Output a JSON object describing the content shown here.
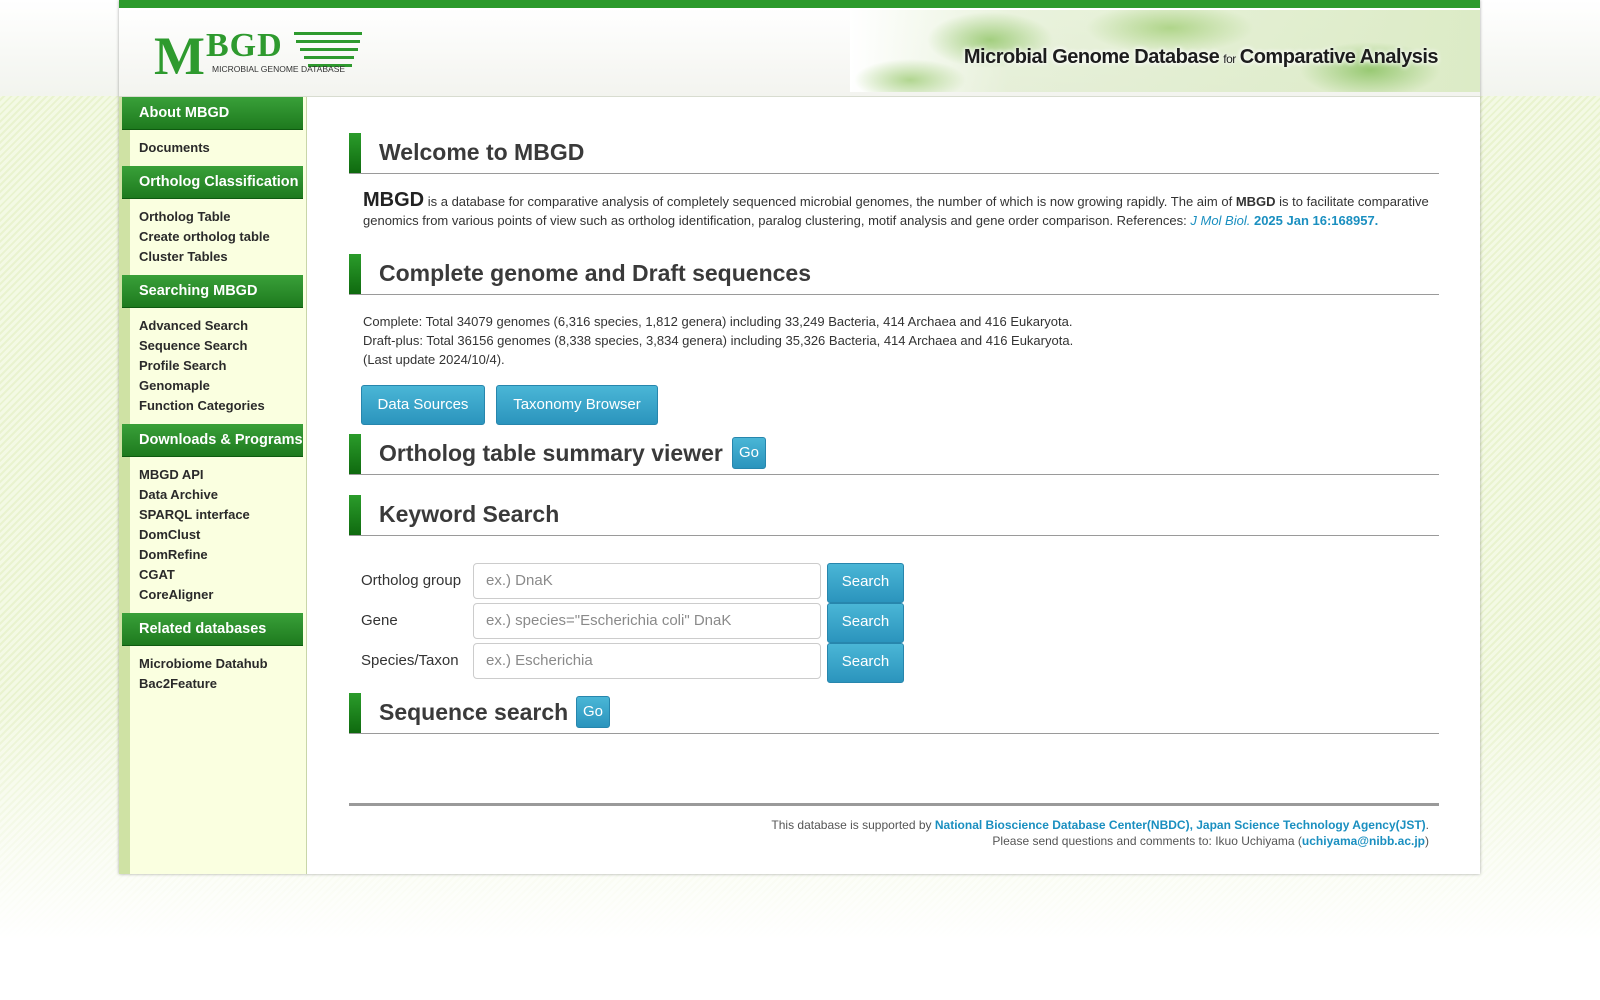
{
  "header": {
    "logo_text": "MBGD",
    "logo_subtext": "MICROBIAL GENOME DATABASE",
    "tagline_part1": "Microbial Genome Database",
    "tagline_for": "for",
    "tagline_part2": "Comparative Analysis"
  },
  "sidebar": {
    "sections": [
      {
        "title": "About MBGD",
        "items": [
          "Documents"
        ]
      },
      {
        "title": "Ortholog Classification",
        "items": [
          "Ortholog Table",
          "Create ortholog table",
          "Cluster Tables"
        ]
      },
      {
        "title": "Searching MBGD",
        "items": [
          "Advanced Search",
          "Sequence Search",
          "Profile Search",
          "Genomaple",
          "Function Categories"
        ]
      },
      {
        "title": "Downloads & Programs",
        "items": [
          "MBGD API",
          "Data Archive",
          "SPARQL interface",
          "DomClust",
          "DomRefine",
          "CGAT",
          "CoreAligner"
        ]
      },
      {
        "title": "Related databases",
        "items": [
          "Microbiome Datahub",
          "Bac2Feature"
        ]
      }
    ]
  },
  "welcome": {
    "title": "Welcome to MBGD",
    "mbgd": "MBGD",
    "text1": " is a database for comparative analysis of completely sequenced microbial genomes, the number of which is now growing rapidly. The aim of ",
    "mbgd2": "MBGD",
    "text2": " is to facilitate comparative genomics from various points of view such as ortholog identification, paralog clustering, motif analysis and gene order comparison. References: ",
    "ref_journal": "J Mol Biol.",
    "ref_detail": "2025 Jan 16:168957."
  },
  "genomes": {
    "title": "Complete genome and Draft sequences",
    "complete": "Complete: Total 34079 genomes (6,316 species, 1,812 genera) including 33,249 Bacteria, 414 Archaea and 416 Eukaryota.",
    "draft": "Draft-plus: Total 36156 genomes (8,338 species, 3,834 genera) including 35,326 Bacteria, 414 Archaea and 416 Eukaryota.",
    "last_update": "(Last update 2024/10/4).",
    "btn_data_sources": "Data Sources",
    "btn_taxonomy": "Taxonomy Browser"
  },
  "ortholog_viewer": {
    "title": "Ortholog table summary viewer",
    "go": "Go"
  },
  "keyword": {
    "title": "Keyword Search",
    "rows": [
      {
        "label": "Ortholog group",
        "placeholder": "ex.) DnaK",
        "button": "Search"
      },
      {
        "label": "Gene",
        "placeholder": "ex.) species=\"Escherichia coli\" DnaK",
        "button": "Search"
      },
      {
        "label": "Species/Taxon",
        "placeholder": "ex.) Escherichia",
        "button": "Search"
      }
    ]
  },
  "sequence_search": {
    "title": "Sequence search",
    "go": "Go"
  },
  "footer": {
    "supported_prefix": "This database is supported by ",
    "supporters": "National Bioscience Database Center(NBDC), Japan Science Technology Agency(JST)",
    "supported_suffix": ".",
    "contact_prefix": "Please send questions and comments to: Ikuo Uchiyama (",
    "email": "uchiyama@nibb.ac.jp",
    "contact_suffix": ")"
  },
  "colors": {
    "accent_green": "#2c9a2c",
    "button_blue": "#2b94bd",
    "link_blue": "#1a8fc0"
  }
}
